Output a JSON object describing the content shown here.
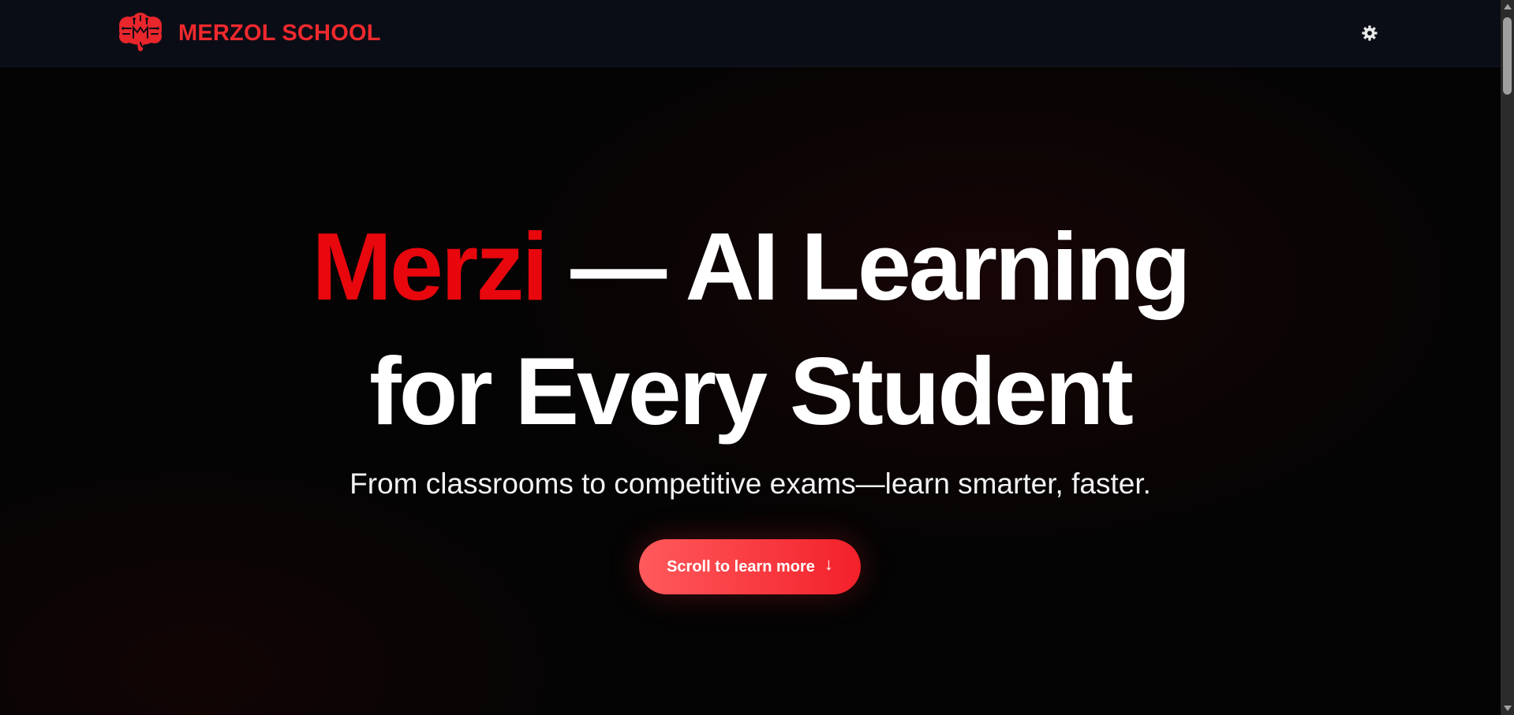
{
  "header": {
    "brand_name": "MERZOL SCHOOL",
    "logo_icon": "brain-icon",
    "theme_toggle_icon": "gear-icon"
  },
  "hero": {
    "title_accent": "Merzi",
    "title_rest_line1": " — AI Learning",
    "title_line2": "for Every Student",
    "subtitle": "From classrooms to competitive exams—learn smarter, faster.",
    "cta_label": "Scroll to learn more",
    "cta_icon": "arrow-down-icon"
  },
  "colors": {
    "accent": "#e8070d",
    "brand": "#f0292e",
    "header_bg": "#0b0d16",
    "page_bg": "#040404",
    "cta_gradient_start": "#ff5a5c",
    "cta_gradient_end": "#f3202a"
  }
}
